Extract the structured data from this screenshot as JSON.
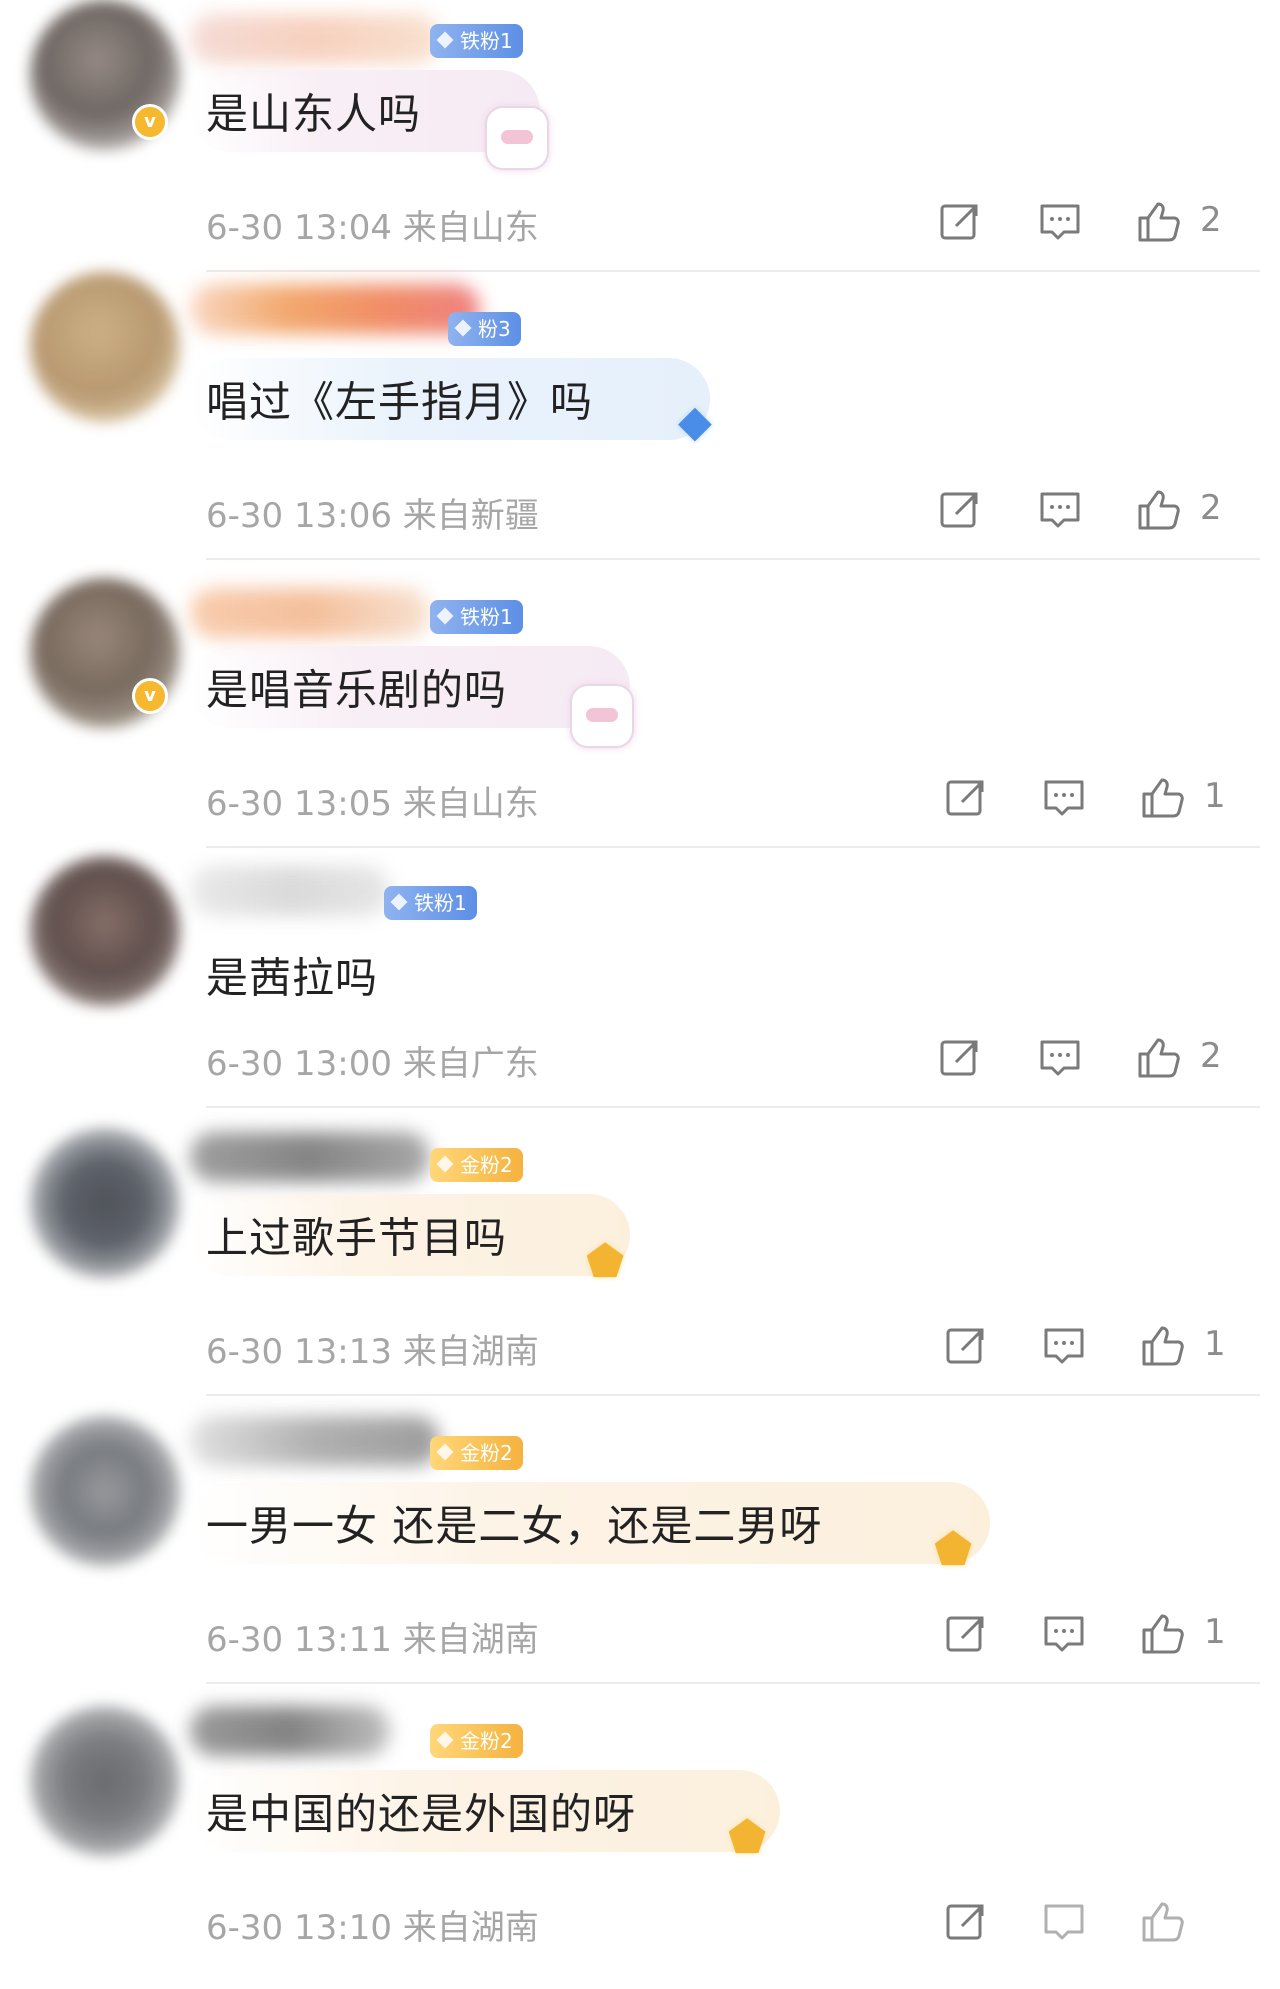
{
  "comments": [
    {
      "text": "是山东人吗",
      "time": "6-30 13:04",
      "location": "来自山东",
      "likes": "2",
      "fan_badge": "铁粉1",
      "fan_type": "iron",
      "bubble": "pink",
      "deco": "bunny-gift-icon"
    },
    {
      "text": "唱过《左手指月》吗",
      "time": "6-30 13:06",
      "location": "来自新疆",
      "likes": "2",
      "fan_badge": "粉3",
      "fan_type": "iron",
      "bubble": "blue",
      "deco": "blue-gem-icon"
    },
    {
      "text": "是唱音乐剧的吗",
      "time": "6-30 13:05",
      "location": "来自山东",
      "likes": "1",
      "fan_badge": "铁粉1",
      "fan_type": "iron",
      "bubble": "pink",
      "deco": "bunny-gift-icon"
    },
    {
      "text": "是茜拉吗",
      "time": "6-30 13:00",
      "location": "来自广东",
      "likes": "2",
      "fan_badge": "铁粉1",
      "fan_type": "iron",
      "bubble": "none",
      "deco": ""
    },
    {
      "text": "上过歌手节目吗",
      "time": "6-30 13:13",
      "location": "来自湖南",
      "likes": "1",
      "fan_badge": "金粉2",
      "fan_type": "gold",
      "bubble": "gold",
      "deco": "gold-medal-icon"
    },
    {
      "text": "一男一女 还是二女，还是二男呀",
      "time": "6-30 13:11",
      "location": "来自湖南",
      "likes": "1",
      "fan_badge": "金粉2",
      "fan_type": "gold",
      "bubble": "gold",
      "deco": "gold-medal-icon"
    },
    {
      "text": "是中国的还是外国的呀",
      "time": "6-30 13:10",
      "location": "来自湖南",
      "likes": "",
      "fan_badge": "金粉2",
      "fan_type": "gold",
      "bubble": "gold",
      "deco": "gold-medal-icon"
    }
  ],
  "icons": {
    "share": "share-icon",
    "reply": "comment-icon",
    "like": "thumbs-up-icon",
    "verified": "verified-badge-icon"
  },
  "colors": {
    "iron_badge": "#5d8fe6",
    "gold_badge": "#f5b23e",
    "meta_text": "#a6a6a6",
    "divider": "#ececec"
  }
}
